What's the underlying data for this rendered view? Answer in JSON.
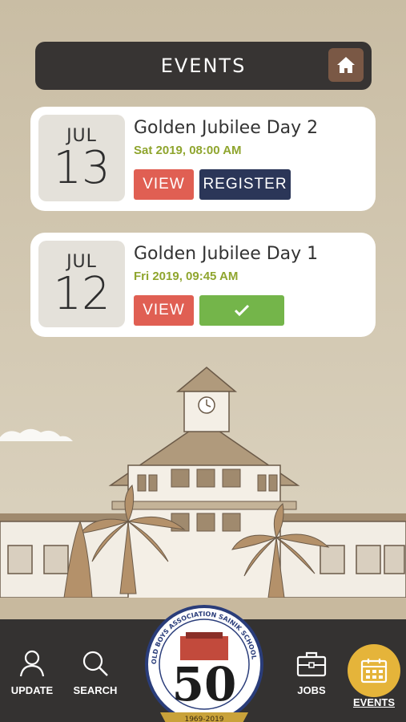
{
  "header": {
    "title": "EVENTS"
  },
  "events": [
    {
      "month": "JUL",
      "day": "13",
      "title": "Golden Jubilee Day 2",
      "datetime": "Sat 2019, 08:00 AM",
      "view_label": "VIEW",
      "register_label": "REGISTER"
    },
    {
      "month": "JUL",
      "day": "12",
      "title": "Golden Jubilee Day 1",
      "datetime": "Fri 2019, 09:45 AM",
      "view_label": "VIEW"
    }
  ],
  "nav": {
    "update": "UPDATE",
    "search": "SEARCH",
    "jobs": "JOBS",
    "events": "EVENTS"
  },
  "logo": {
    "top_text": "OLD BOYS ASSOCIATION SAINIK SCHOOL KAZHAKOOTAM",
    "number": "50",
    "ribbon": "1969-2019"
  },
  "colors": {
    "accent_events": "#e5b43a",
    "view_button": "#e05f53",
    "register_button": "#2b3658",
    "registered_button": "#74b54a",
    "date_text": "#8fa52e"
  }
}
